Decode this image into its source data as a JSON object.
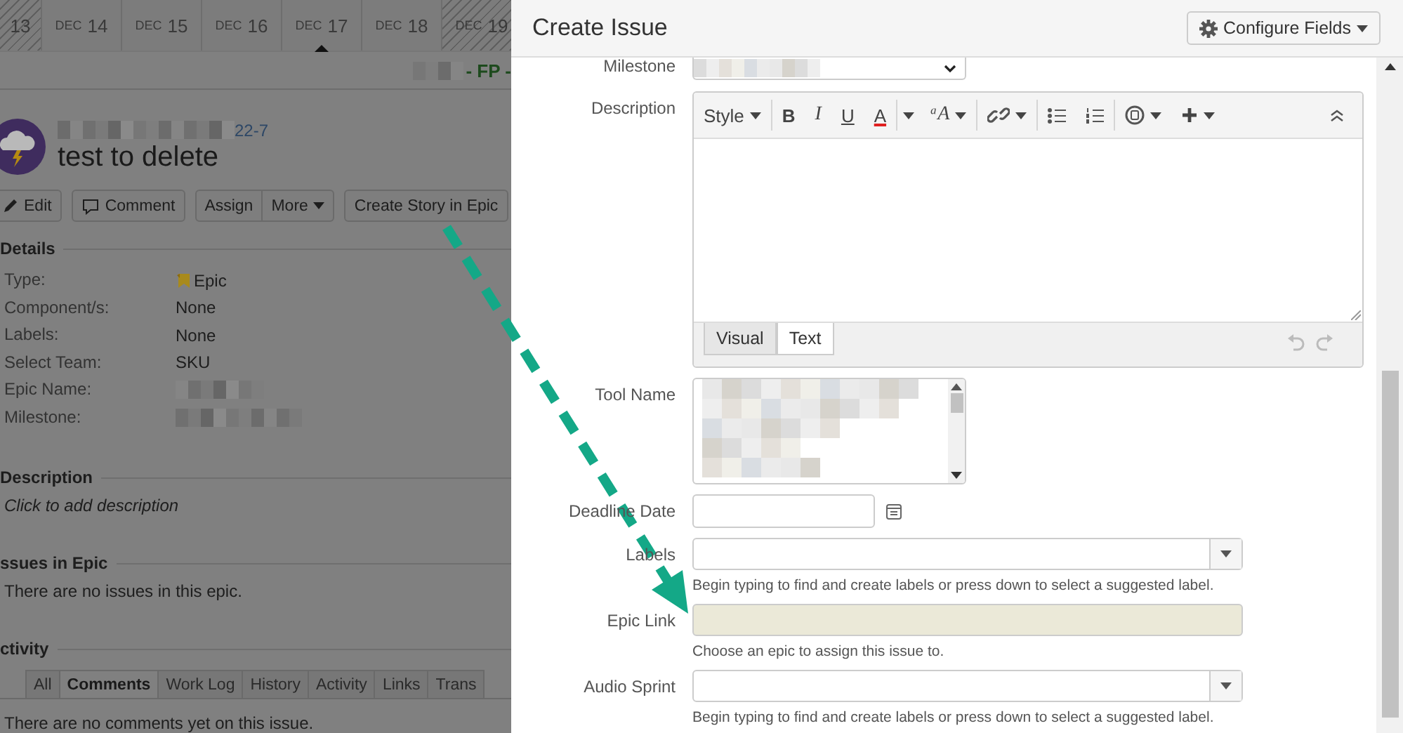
{
  "calendar": [
    {
      "day": "13",
      "weekend": true,
      "selected": false
    },
    {
      "month": "DEC",
      "day": "14",
      "weekend": false,
      "selected": false
    },
    {
      "month": "DEC",
      "day": "15",
      "weekend": false,
      "selected": false
    },
    {
      "month": "DEC",
      "day": "16",
      "weekend": false,
      "selected": false
    },
    {
      "month": "DEC",
      "day": "17",
      "weekend": false,
      "selected": true
    },
    {
      "month": "DEC",
      "day": "18",
      "weekend": false,
      "selected": false
    },
    {
      "month": "DEC",
      "day": "19",
      "weekend": true,
      "selected": false
    }
  ],
  "project_crumb": "- FP -",
  "issue": {
    "key": "22-7",
    "title": "test to delete"
  },
  "actions": [
    {
      "buttons": [
        {
          "kind": "icon",
          "label": "Edit"
        }
      ]
    },
    {
      "buttons": [
        {
          "kind": "icon",
          "label": "Comment"
        }
      ]
    },
    {
      "buttons": [
        {
          "kind": "plain",
          "label": "Assign"
        },
        {
          "kind": "menu",
          "label": "More"
        }
      ]
    },
    {
      "buttons": [
        {
          "kind": "plain",
          "label": "Create Story in Epic"
        }
      ]
    }
  ],
  "details": {
    "heading": "Details",
    "rows": [
      {
        "label": "Type:",
        "value": "Epic"
      },
      {
        "label": "Component/s:",
        "value": "None"
      },
      {
        "label": "Labels:",
        "value": "None"
      },
      {
        "label": "Select Team:",
        "value": "SKU"
      },
      {
        "label": "Epic Name:"
      },
      {
        "label": "Milestone:"
      }
    ]
  },
  "description": {
    "heading": "Description",
    "text": "Click to add description"
  },
  "epic_issues": {
    "heading": "ssues in Epic",
    "text": "There are no issues in this epic."
  },
  "activity": {
    "heading": "ctivity",
    "tabs": [
      {
        "label": "All",
        "selected": false
      },
      {
        "label": "Comments",
        "selected": true
      },
      {
        "label": "Work Log",
        "selected": false
      },
      {
        "label": "History",
        "selected": false
      },
      {
        "label": "Activity",
        "selected": false
      },
      {
        "label": "Links",
        "selected": false
      },
      {
        "label": "Trans",
        "selected": false
      }
    ],
    "text": "There are no comments yet on this issue."
  },
  "dialog": {
    "title": "Create Issue",
    "configure_button": "Configure Fields",
    "fields": [
      {
        "kind": "select",
        "label": "Milestone"
      },
      {
        "kind": "editor",
        "label": "Description",
        "toolbar": [
          {
            "kind": "menu",
            "label": "Style"
          },
          {
            "kind": "sep"
          },
          {
            "kind": "bold",
            "label": "B"
          },
          {
            "kind": "italic",
            "label": "I"
          },
          {
            "kind": "underline",
            "label": "U"
          },
          {
            "kind": "color",
            "label": "A"
          },
          {
            "kind": "sep"
          },
          {
            "kind": "dropdown"
          },
          {
            "kind": "size",
            "label": "ᵃA"
          },
          {
            "kind": "sep"
          },
          {
            "kind": "link"
          },
          {
            "kind": "sep"
          },
          {
            "kind": "bullets"
          },
          {
            "kind": "numbers"
          },
          {
            "kind": "sep"
          },
          {
            "kind": "emoji"
          },
          {
            "kind": "insert"
          },
          {
            "kind": "spacer"
          },
          {
            "kind": "collapse"
          }
        ],
        "modes": [
          {
            "label": "Visual",
            "selected": false
          },
          {
            "label": "Text",
            "selected": true
          }
        ]
      },
      {
        "kind": "listbox",
        "label": "Tool Name"
      },
      {
        "kind": "date",
        "label": "Deadline Date"
      },
      {
        "kind": "picker",
        "label": "Labels",
        "hint": "Begin typing to find and create labels or press down to select a suggested label."
      },
      {
        "kind": "text",
        "label": "Epic Link",
        "highlighted": true,
        "hint": "Choose an epic to assign this issue to."
      },
      {
        "kind": "picker",
        "label": "Audio Sprint",
        "hint": "Begin typing to find and create labels or press down to select a suggested label."
      }
    ]
  }
}
